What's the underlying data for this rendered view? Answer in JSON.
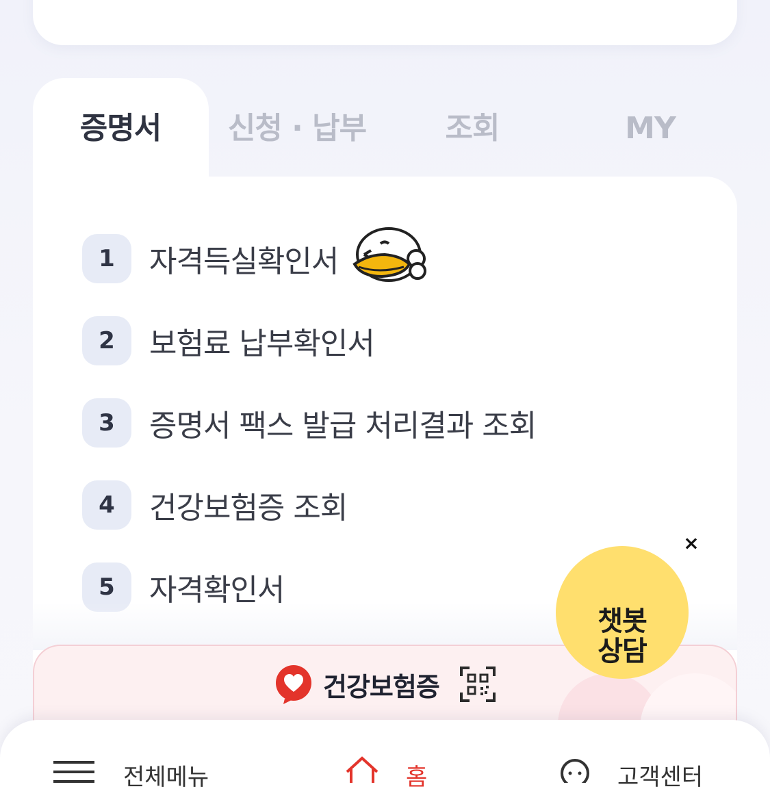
{
  "tabs": [
    {
      "label": "증명서",
      "active": true
    },
    {
      "label": "신청 · 납부",
      "active": false
    },
    {
      "label": "조회",
      "active": false
    },
    {
      "label": "MY",
      "active": false
    }
  ],
  "certificate_list": [
    {
      "number": "1",
      "label": "자격득실확인서",
      "sticker": "ryan-character"
    },
    {
      "number": "2",
      "label": "보험료 납부확인서"
    },
    {
      "number": "3",
      "label": "증명서 팩스 발급 처리결과 조회"
    },
    {
      "number": "4",
      "label": "건강보험증 조회"
    },
    {
      "number": "5",
      "label": "자격확인서"
    }
  ],
  "health_card_banner": {
    "label": "건강보험증",
    "icon": "heart-logo-icon",
    "qr_icon": "qr-code-icon"
  },
  "chatbot": {
    "label": "챗봇\n상담",
    "close": "×"
  },
  "bottom_nav": [
    {
      "label": "전체메뉴",
      "icon": "menu-icon"
    },
    {
      "label": "홈",
      "icon": "home-icon"
    },
    {
      "label": "고객센터",
      "icon": "headset-icon"
    }
  ],
  "colors": {
    "accent_red": "#e3342b",
    "chatbot_yellow": "#ffdf6e",
    "badge_bg": "#e7ebf6"
  }
}
